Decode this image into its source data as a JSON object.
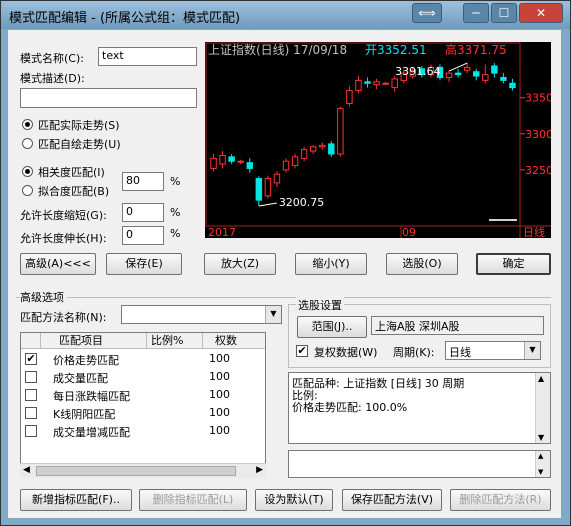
{
  "window": {
    "title": "模式匹配编辑 - (所属公式组：模式匹配)",
    "btn_swap": "⟺",
    "btn_min": "─",
    "btn_max": "☐",
    "btn_close": "✕"
  },
  "form": {
    "name_label": "模式名称(C):",
    "name_value": "text",
    "desc_label": "模式描述(D):",
    "desc_value": "",
    "radio_actual": "匹配实际走势(S)",
    "radio_custom": "匹配自绘走势(U)",
    "radio_corr": "相关度匹配(I)",
    "radio_fit": "拟合度匹配(B)",
    "corr_value": "80",
    "pct1": "%",
    "shrink_label": "允许长度缩短(G):",
    "shrink_value": "0",
    "pct2": "%",
    "extend_label": "允许长度伸长(H):",
    "extend_value": "0",
    "pct3": "%"
  },
  "chart_data": {
    "type": "candlestick",
    "title": "上证指数(日线) 17/09/18",
    "open_label": "开3352.51",
    "high_label": "高3371.75",
    "annotation_high": "3391.64",
    "annotation_low": "3200.75",
    "x_tick_labels": [
      "2017",
      "09",
      "日线"
    ],
    "y_tick_labels": [
      "3350",
      "3300",
      "3250"
    ],
    "ylim": [
      3175,
      3405
    ],
    "colors": {
      "up": "#ff3232",
      "down": "#00e6e6",
      "text": "#c0c0c0",
      "red": "#ff3232"
    },
    "candles": [
      {
        "o": 3252,
        "c": 3266,
        "h": 3272,
        "l": 3248
      },
      {
        "o": 3258,
        "c": 3270,
        "h": 3276,
        "l": 3252
      },
      {
        "o": 3268,
        "c": 3262,
        "h": 3272,
        "l": 3258
      },
      {
        "o": 3262,
        "c": 3262,
        "h": 3264,
        "l": 3258
      },
      {
        "o": 3260,
        "c": 3252,
        "h": 3266,
        "l": 3246
      },
      {
        "o": 3238,
        "c": 3208,
        "h": 3241,
        "l": 3200
      },
      {
        "o": 3214,
        "c": 3238,
        "h": 3242,
        "l": 3210
      },
      {
        "o": 3232,
        "c": 3244,
        "h": 3248,
        "l": 3226
      },
      {
        "o": 3250,
        "c": 3262,
        "h": 3266,
        "l": 3246
      },
      {
        "o": 3256,
        "c": 3268,
        "h": 3272,
        "l": 3252
      },
      {
        "o": 3266,
        "c": 3278,
        "h": 3282,
        "l": 3262
      },
      {
        "o": 3276,
        "c": 3282,
        "h": 3284,
        "l": 3272
      },
      {
        "o": 3282,
        "c": 3284,
        "h": 3288,
        "l": 3278
      },
      {
        "o": 3286,
        "c": 3272,
        "h": 3290,
        "l": 3268
      },
      {
        "o": 3272,
        "c": 3335,
        "h": 3338,
        "l": 3268
      },
      {
        "o": 3342,
        "c": 3360,
        "h": 3366,
        "l": 3338
      },
      {
        "o": 3360,
        "c": 3374,
        "h": 3380,
        "l": 3356
      },
      {
        "o": 3372,
        "c": 3370,
        "h": 3378,
        "l": 3364
      },
      {
        "o": 3368,
        "c": 3372,
        "h": 3376,
        "l": 3362
      },
      {
        "o": 3370,
        "c": 3370,
        "h": 3372,
        "l": 3368
      },
      {
        "o": 3364,
        "c": 3376,
        "h": 3380,
        "l": 3358
      },
      {
        "o": 3374,
        "c": 3384,
        "h": 3388,
        "l": 3370
      },
      {
        "o": 3380,
        "c": 3388,
        "h": 3392,
        "l": 3376
      },
      {
        "o": 3390,
        "c": 3382,
        "h": 3394,
        "l": 3378
      },
      {
        "o": 3382,
        "c": 3392,
        "h": 3396,
        "l": 3378
      },
      {
        "o": 3392,
        "c": 3378,
        "h": 3396,
        "l": 3374
      },
      {
        "o": 3378,
        "c": 3384,
        "h": 3388,
        "l": 3372
      },
      {
        "o": 3384,
        "c": 3382,
        "h": 3390,
        "l": 3378
      },
      {
        "o": 3388,
        "c": 3392,
        "h": 3398,
        "l": 3384
      },
      {
        "o": 3386,
        "c": 3380,
        "h": 3390,
        "l": 3374
      },
      {
        "o": 3374,
        "c": 3382,
        "h": 3396,
        "l": 3370
      },
      {
        "o": 3394,
        "c": 3384,
        "h": 3398,
        "l": 3378
      },
      {
        "o": 3378,
        "c": 3374,
        "h": 3384,
        "l": 3370
      },
      {
        "o": 3370,
        "c": 3364,
        "h": 3376,
        "l": 3360
      }
    ]
  },
  "buttons": {
    "advanced": "高级(A)<<<",
    "save": "保存(E)",
    "zoom_in": "放大(Z)",
    "zoom_out": "缩小(Y)",
    "select": "选股(O)",
    "ok": "确定"
  },
  "advanced": {
    "section_label": "高级选项",
    "method_label": "匹配方法名称(N):",
    "method_value": "",
    "table_headers": [
      "匹配项目",
      "比例%",
      "权数"
    ],
    "rows": [
      {
        "checked": "✔",
        "name": "价格走势匹配",
        "weight": "100"
      },
      {
        "checked": "",
        "name": "成交量匹配",
        "weight": "100"
      },
      {
        "checked": "",
        "name": "每日涨跌幅匹配",
        "weight": "100"
      },
      {
        "checked": "",
        "name": "K线阴阳匹配",
        "weight": "100"
      },
      {
        "checked": "",
        "name": "成交量增减匹配",
        "weight": "100"
      }
    ]
  },
  "stock": {
    "group_label": "选股设置",
    "range_btn": "范围(J)..",
    "range_value": "上海A股  深圳A股",
    "restore_check": "✔",
    "restore_label": "复权数据(W)",
    "period_label": "周期(K):",
    "period_value": "日线",
    "info_line1": "匹配品种: 上证指数 [日线] 30 周期",
    "info_line2": "比例:",
    "info_line3": "价格走势匹配: 100.0%"
  },
  "bottom": {
    "add": "新增指标匹配(F)..",
    "delete": "删除指标匹配(L)",
    "default": "设为默认(T)",
    "save_method": "保存匹配方法(V)",
    "delete_method": "删除匹配方法(R)"
  },
  "scroll": {
    "left": "◀",
    "right": "▶",
    "up": "▲",
    "down": "▼"
  },
  "icons": {
    "dropdown": "▼"
  }
}
